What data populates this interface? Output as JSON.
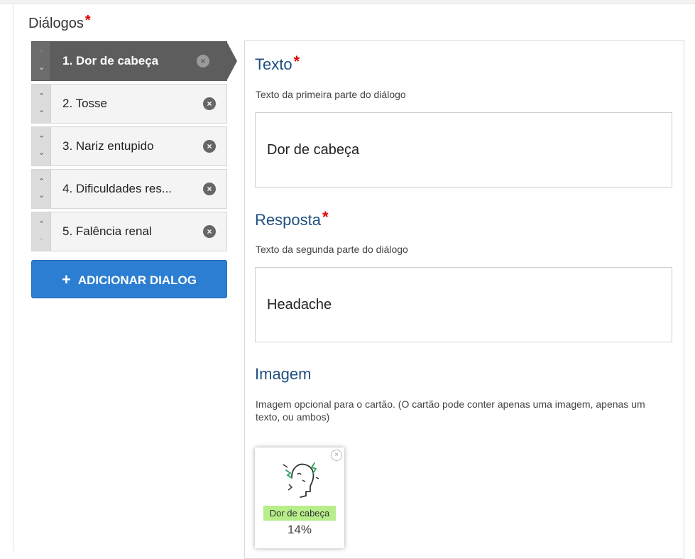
{
  "section": {
    "title": "Diálogos",
    "required_mark": "*"
  },
  "dialogs": [
    {
      "label": "1. Dor de cabeça"
    },
    {
      "label": "2. Tosse"
    },
    {
      "label": "3. Nariz entupido"
    },
    {
      "label": "4. Dificuldades res..."
    },
    {
      "label": "5. Falência renal"
    }
  ],
  "add_button": {
    "plus": "+",
    "label": "ADICIONAR DIALOG"
  },
  "fields": {
    "texto": {
      "label": "Texto",
      "required_mark": "*",
      "description": "Texto da primeira parte do diálogo",
      "value": "Dor de cabeça"
    },
    "resposta": {
      "label": "Resposta",
      "required_mark": "*",
      "description": "Texto da segunda parte do diálogo",
      "value": "Headache"
    },
    "imagem": {
      "label": "Imagem",
      "description": "Imagem opcional para o cartão. (O cartão pode conter apenas uma imagem, apenas um texto, ou ambos)",
      "thumbnail": {
        "caption": "Dor de cabeça",
        "percent": "14%",
        "close": "×"
      }
    }
  },
  "icons": {
    "remove": "remove-icon",
    "up": "arrow-up-icon",
    "down": "arrow-down-icon",
    "headache": "headache-icon"
  },
  "colors": {
    "accent_blue": "#2c7ed2",
    "label_blue": "#1f4f80",
    "active_item": "#5d5d5d",
    "required": "#e00000",
    "caption_green": "#b7ee8a"
  }
}
